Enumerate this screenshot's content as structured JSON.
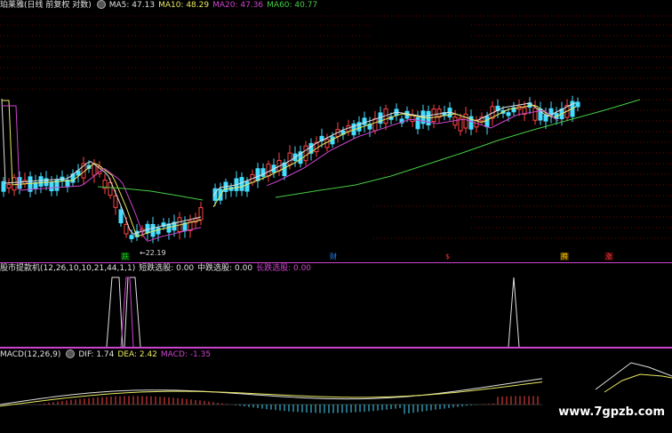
{
  "main": {
    "title": "珀莱雅(日线 前复权 对数)",
    "ma": [
      {
        "label": "MA5: 47.13",
        "color": "#e0e0e0"
      },
      {
        "label": "MA10: 48.29",
        "color": "#e8e860"
      },
      {
        "label": "MA20: 47.36",
        "color": "#cc44cc"
      },
      {
        "label": "MA60: 40.77",
        "color": "#44cc44"
      }
    ],
    "low_label": "22.19",
    "markers": [
      {
        "text": "跌",
        "color": "#22cc22",
        "bg": "#003300"
      },
      {
        "text": "财",
        "color": "#2288ff",
        "bg": "#000"
      },
      {
        "text": "$",
        "color": "#ff3333",
        "bg": "#000"
      },
      {
        "text": "腾",
        "color": "#ffcc00",
        "bg": "#332200"
      },
      {
        "text": "涨",
        "color": "#ff4444",
        "bg": "#330000"
      }
    ]
  },
  "indicator": {
    "title": "股市提款机(12,26,10,10,21,44,1,1)",
    "items": [
      {
        "label": "短跌选股: 0.00",
        "color": "#e0e0e0"
      },
      {
        "label": "中跌选股: 0.00",
        "color": "#e0e0e0"
      },
      {
        "label": "长跌选股: 0.00",
        "color": "#cc44cc"
      }
    ]
  },
  "macd": {
    "title": "MACD(12,26,9)",
    "items": [
      {
        "label": "DIF: 1.74",
        "color": "#e0e0e0"
      },
      {
        "label": "DEA: 2.42",
        "color": "#e8e860"
      },
      {
        "label": "MACD: -1.35",
        "color": "#cc44cc"
      }
    ]
  },
  "watermark": "www.7gpzb.com"
}
